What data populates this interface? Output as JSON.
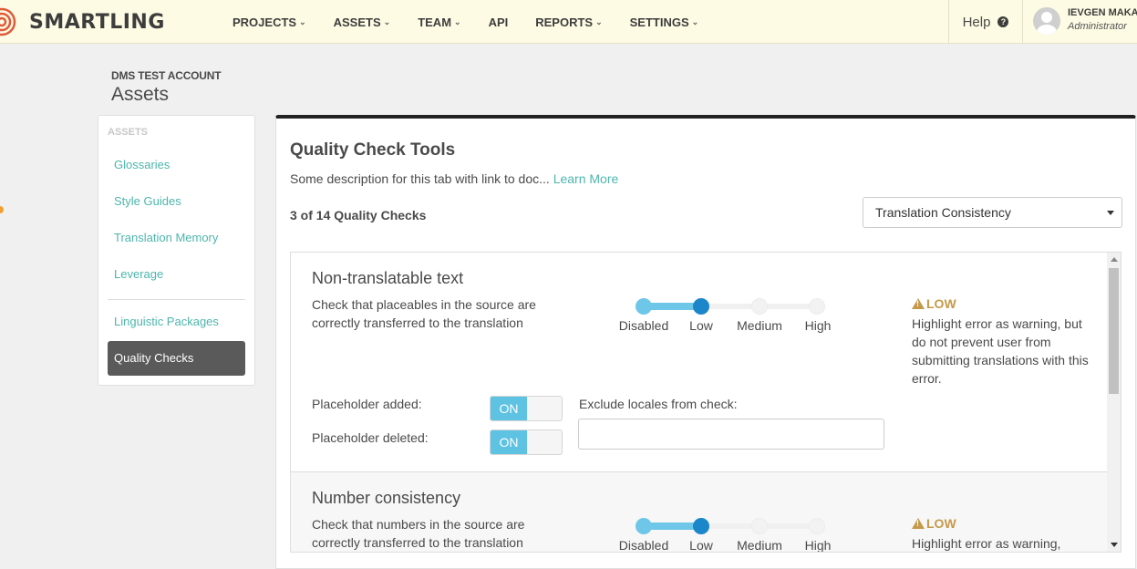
{
  "brand": {
    "name": "SMARTLING"
  },
  "nav": [
    {
      "label": "PROJECTS",
      "dropdown": true
    },
    {
      "label": "ASSETS",
      "dropdown": true
    },
    {
      "label": "TEAM",
      "dropdown": true
    },
    {
      "label": "API",
      "dropdown": false
    },
    {
      "label": "REPORTS",
      "dropdown": true
    },
    {
      "label": "SETTINGS",
      "dropdown": true
    }
  ],
  "help": {
    "label": "Help"
  },
  "user": {
    "name": "IEVGEN MAKA",
    "role": "Administrator"
  },
  "account": "DMS TEST ACCOUNT",
  "page_title": "Assets",
  "sidebar": {
    "heading": "ASSETS",
    "items": [
      {
        "label": "Glossaries",
        "active": false
      },
      {
        "label": "Style Guides",
        "active": false
      },
      {
        "label": "Translation Memory",
        "active": false
      },
      {
        "label": "Leverage",
        "active": false
      },
      {
        "label": "Linguistic Packages",
        "active": false
      },
      {
        "label": "Quality Checks",
        "active": true
      }
    ]
  },
  "main": {
    "title": "Quality Check Tools",
    "description": "Some description for this tab with link to doc...",
    "learn_more": "Learn More",
    "count": "3 of 14 Quality Checks",
    "filter": {
      "selected": "Translation Consistency"
    }
  },
  "slider_labels": [
    "Disabled",
    "Low",
    "Medium",
    "High"
  ],
  "checks": [
    {
      "title": "Non-translatable text",
      "description": "Check that placeables in the source are correctly transferred to the translation",
      "level": "Low",
      "severity": "LOW",
      "severity_desc": "Highlight error as warning, but do not prevent user from submitting translations with this error.",
      "options": [
        {
          "label": "Placeholder added:",
          "state": "ON"
        },
        {
          "label": "Placeholder deleted:",
          "state": "ON"
        }
      ],
      "exclude_label": "Exclude locales from check:"
    },
    {
      "title": "Number consistency",
      "description": "Check that numbers in the source are correctly transferred to the translation",
      "level": "Low",
      "severity": "LOW",
      "severity_desc": "Highlight error as warning,"
    }
  ],
  "colors": {
    "header_bg": "#fdfbe3",
    "accent_teal": "#4db6ac",
    "slider_blue": "#1b86c9",
    "slider_light": "#6ec7e8",
    "warning": "#c5994a",
    "active_nav": "#5a5a5a"
  },
  "icons": [
    "logo-icon",
    "chevron-down-icon",
    "help-icon",
    "avatar-icon",
    "warning-icon",
    "caret-down-icon"
  ]
}
